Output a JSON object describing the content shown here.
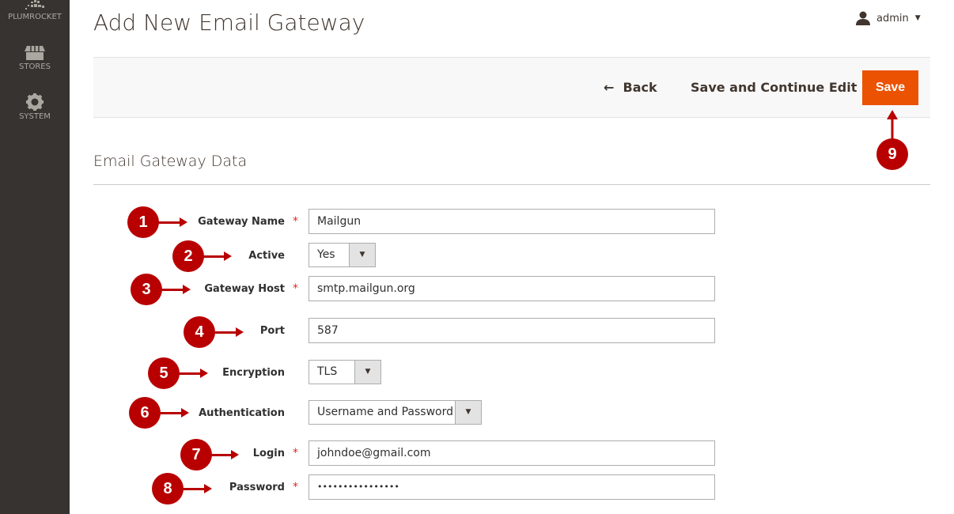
{
  "sidebar": {
    "items": [
      {
        "label": "PLUMROCKET",
        "icon": "plumrocket-logo-icon"
      },
      {
        "label": "STORES",
        "icon": "store-icon"
      },
      {
        "label": "SYSTEM",
        "icon": "gear-icon"
      }
    ]
  },
  "header": {
    "title": "Add New Email Gateway",
    "user": "admin"
  },
  "actions": {
    "back": "Back",
    "save_continue": "Save and Continue Edit",
    "save": "Save"
  },
  "section": {
    "title": "Email Gateway Data"
  },
  "form": {
    "gateway_name": {
      "label": "Gateway Name",
      "value": "Mailgun",
      "required": true
    },
    "active": {
      "label": "Active",
      "value": "Yes"
    },
    "gateway_host": {
      "label": "Gateway Host",
      "value": "smtp.mailgun.org",
      "required": true
    },
    "port": {
      "label": "Port",
      "value": "587"
    },
    "encryption": {
      "label": "Encryption",
      "value": "TLS"
    },
    "authentication": {
      "label": "Authentication",
      "value": "Username and Password"
    },
    "login": {
      "label": "Login",
      "value": "johndoe@gmail.com",
      "required": true
    },
    "password": {
      "label": "Password",
      "value": "••••••••••••••••",
      "required": true
    },
    "required_mark": "*"
  },
  "annotations": [
    "1",
    "2",
    "3",
    "4",
    "5",
    "6",
    "7",
    "8",
    "9"
  ],
  "colors": {
    "accent": "#eb5202",
    "annotation": "#b80000",
    "sidebar": "#373330"
  }
}
